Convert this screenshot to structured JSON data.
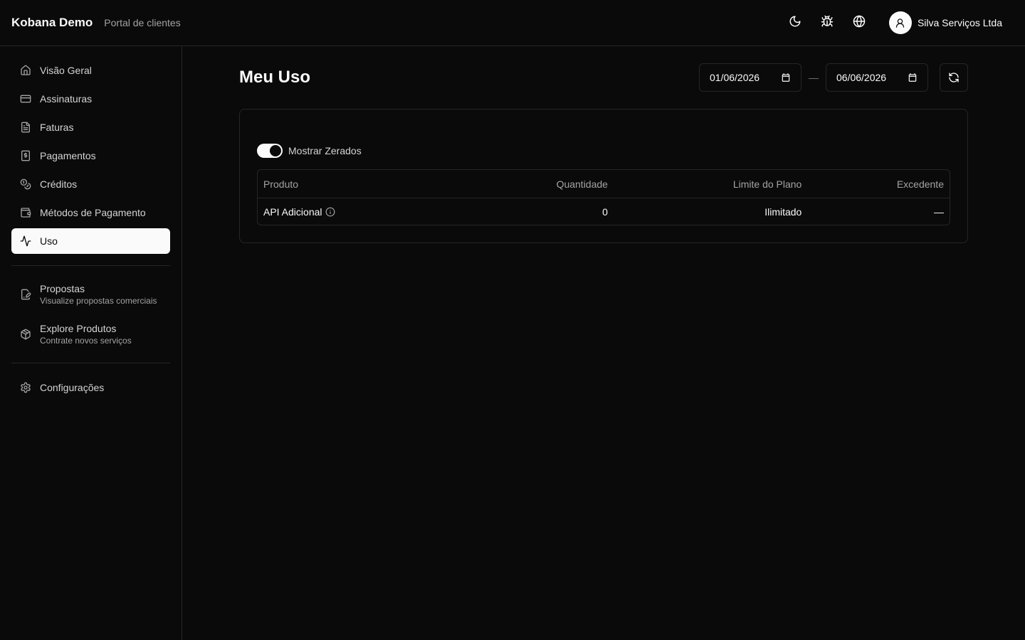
{
  "header": {
    "brand": "Kobana Demo",
    "subtitle": "Portal de clientes",
    "icons": [
      "moon-icon",
      "bug-icon",
      "globe-icon"
    ],
    "user_name": "Silva Serviços Ltda"
  },
  "sidebar": {
    "items": [
      {
        "label": "Visão Geral",
        "icon": "home-icon"
      },
      {
        "label": "Assinaturas",
        "icon": "credit-card-icon"
      },
      {
        "label": "Faturas",
        "icon": "file-text-icon"
      },
      {
        "label": "Pagamentos",
        "icon": "receipt-dollar-icon"
      },
      {
        "label": "Créditos",
        "icon": "coins-icon"
      },
      {
        "label": "Métodos de Pagamento",
        "icon": "wallet-icon"
      },
      {
        "label": "Uso",
        "icon": "activity-icon",
        "active": true
      }
    ],
    "secondary": [
      {
        "label": "Propostas",
        "description": "Visualize propostas comerciais",
        "icon": "file-signature-icon"
      },
      {
        "label": "Explore Produtos",
        "description": "Contrate novos serviços",
        "icon": "package-icon"
      }
    ],
    "settings": {
      "label": "Configurações",
      "icon": "gear-icon"
    }
  },
  "main": {
    "title": "Meu Uso",
    "date_from": "01/06/2026",
    "date_separator": "—",
    "date_to": "06/06/2026",
    "toggle": {
      "label": "Mostrar Zerados",
      "on": true
    },
    "table": {
      "columns": [
        "Produto",
        "Quantidade",
        "Limite do Plano",
        "Excedente"
      ],
      "rows": [
        {
          "produto": "API Adicional",
          "quantidade": "0",
          "limite": "Ilimitado",
          "excedente": "—"
        }
      ]
    }
  },
  "colors": {
    "background": "#0a0a0a",
    "border": "#262626",
    "foreground": "#fafafa",
    "muted": "#a3a3a3"
  }
}
